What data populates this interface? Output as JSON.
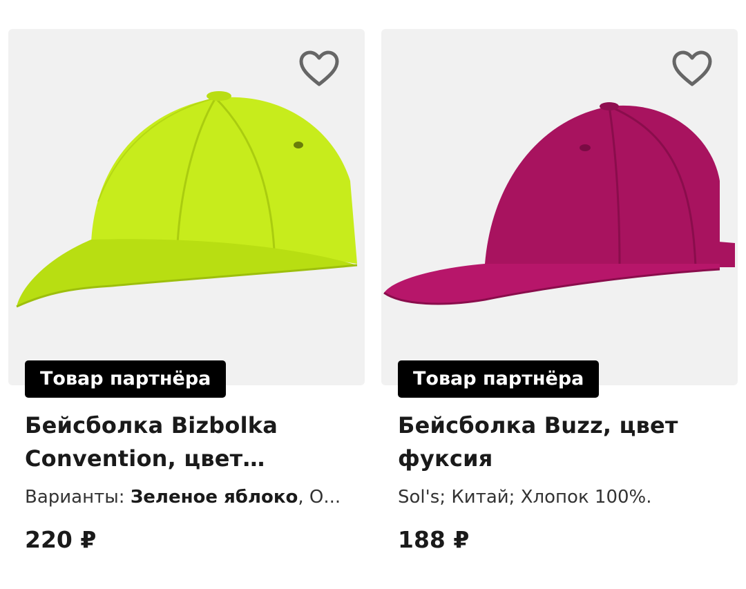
{
  "products": [
    {
      "badge": "Товар партнёра",
      "title": "Бейсболка Bizbolka Convention, цвет зелён...",
      "variants_label": "Варианты: ",
      "variants_bold": "Зеленое яблоко",
      "variants_rest": ", О...",
      "price": "220 ₽",
      "cap_color": "#c7ec1c",
      "favorite_icon": "heart-outline-icon"
    },
    {
      "badge": "Товар партнёра",
      "title": "Бейсболка Buzz, цвет фуксия",
      "meta": "Sol's; Китай; Хлопок 100%.",
      "price": "188 ₽",
      "cap_color": "#a8135f",
      "favorite_icon": "heart-outline-icon"
    }
  ]
}
